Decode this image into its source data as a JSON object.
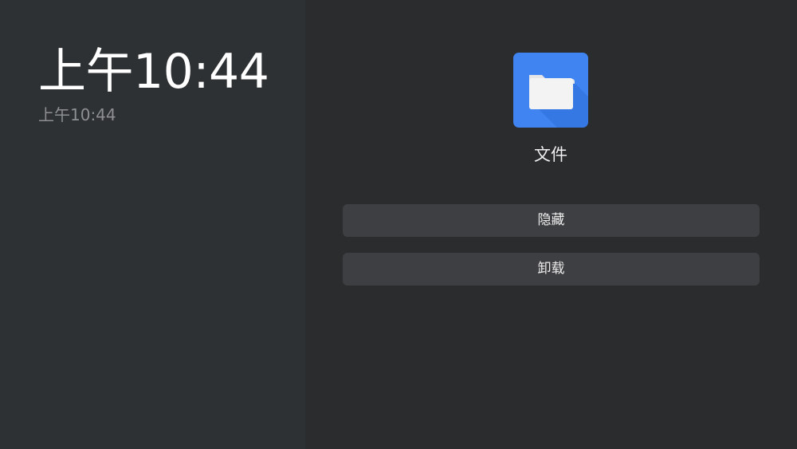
{
  "left_panel": {
    "clock_large": "上午10:44",
    "clock_small": "上午10:44"
  },
  "app": {
    "icon": "folder-icon",
    "icon_color": "#3f84f0",
    "name": "文件"
  },
  "actions": {
    "hide_label": "隐藏",
    "uninstall_label": "卸载"
  }
}
